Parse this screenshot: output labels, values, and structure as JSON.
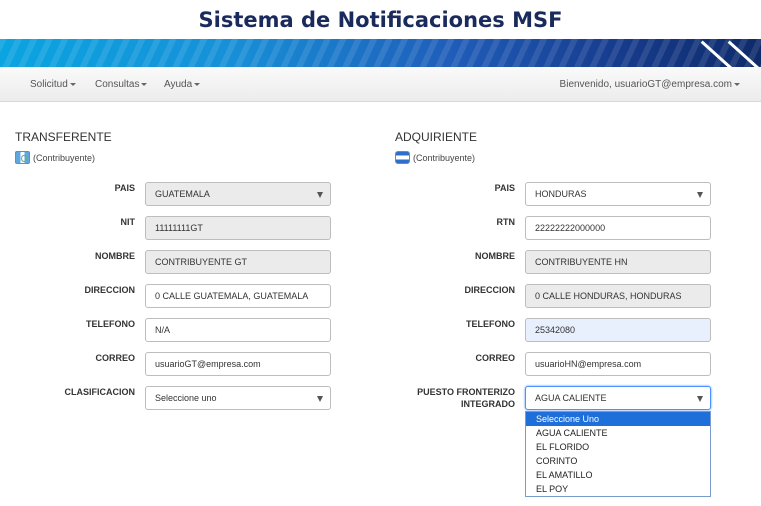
{
  "header": {
    "title": "Sistema de Notificaciones MSF"
  },
  "nav": {
    "items": [
      "Solicitud",
      "Consultas",
      "Ayuda"
    ],
    "welcome": "Bienvenido, usuarioGT@empresa.com"
  },
  "transferente": {
    "title": "TRANSFERENTE",
    "subtitle": "(Contribuyente)",
    "labels": {
      "pais": "PAIS",
      "nit": "NIT",
      "nombre": "NOMBRE",
      "direccion": "DIRECCION",
      "telefono": "TELEFONO",
      "correo": "CORREO",
      "clasificacion": "CLASIFICACION"
    },
    "values": {
      "pais": "GUATEMALA",
      "nit": "11111111GT",
      "nombre": "CONTRIBUYENTE GT",
      "direccion": "0 CALLE GUATEMALA, GUATEMALA",
      "telefono": "N/A",
      "correo": "usuarioGT@empresa.com",
      "clasificacion": "Seleccione uno"
    }
  },
  "adquiriente": {
    "title": "ADQUIRIENTE",
    "subtitle": "(Contribuyente)",
    "labels": {
      "pais": "PAIS",
      "rtn": "RTN",
      "nombre": "NOMBRE",
      "direccion": "DIRECCION",
      "telefono": "TELEFONO",
      "correo": "CORREO",
      "puesto_line1": "PUESTO FRONTERIZO",
      "puesto_line2": "INTEGRADO"
    },
    "values": {
      "pais": "HONDURAS",
      "rtn": "22222222000000",
      "nombre": "CONTRIBUYENTE HN",
      "direccion": "0 CALLE HONDURAS, HONDURAS",
      "telefono": "25342080",
      "correo": "usuarioHN@empresa.com",
      "puesto": "AGUA CALIENTE"
    },
    "puesto_options": [
      "Seleccione Uno",
      "AGUA CALIENTE",
      "EL FLORIDO",
      "CORINTO",
      "EL AMATILLO",
      "EL POY"
    ],
    "puesto_highlighted_index": 0
  },
  "colors": {
    "title": "#1b2a5c",
    "highlight": "#1e6fd9",
    "focus": "#4d90fe"
  }
}
